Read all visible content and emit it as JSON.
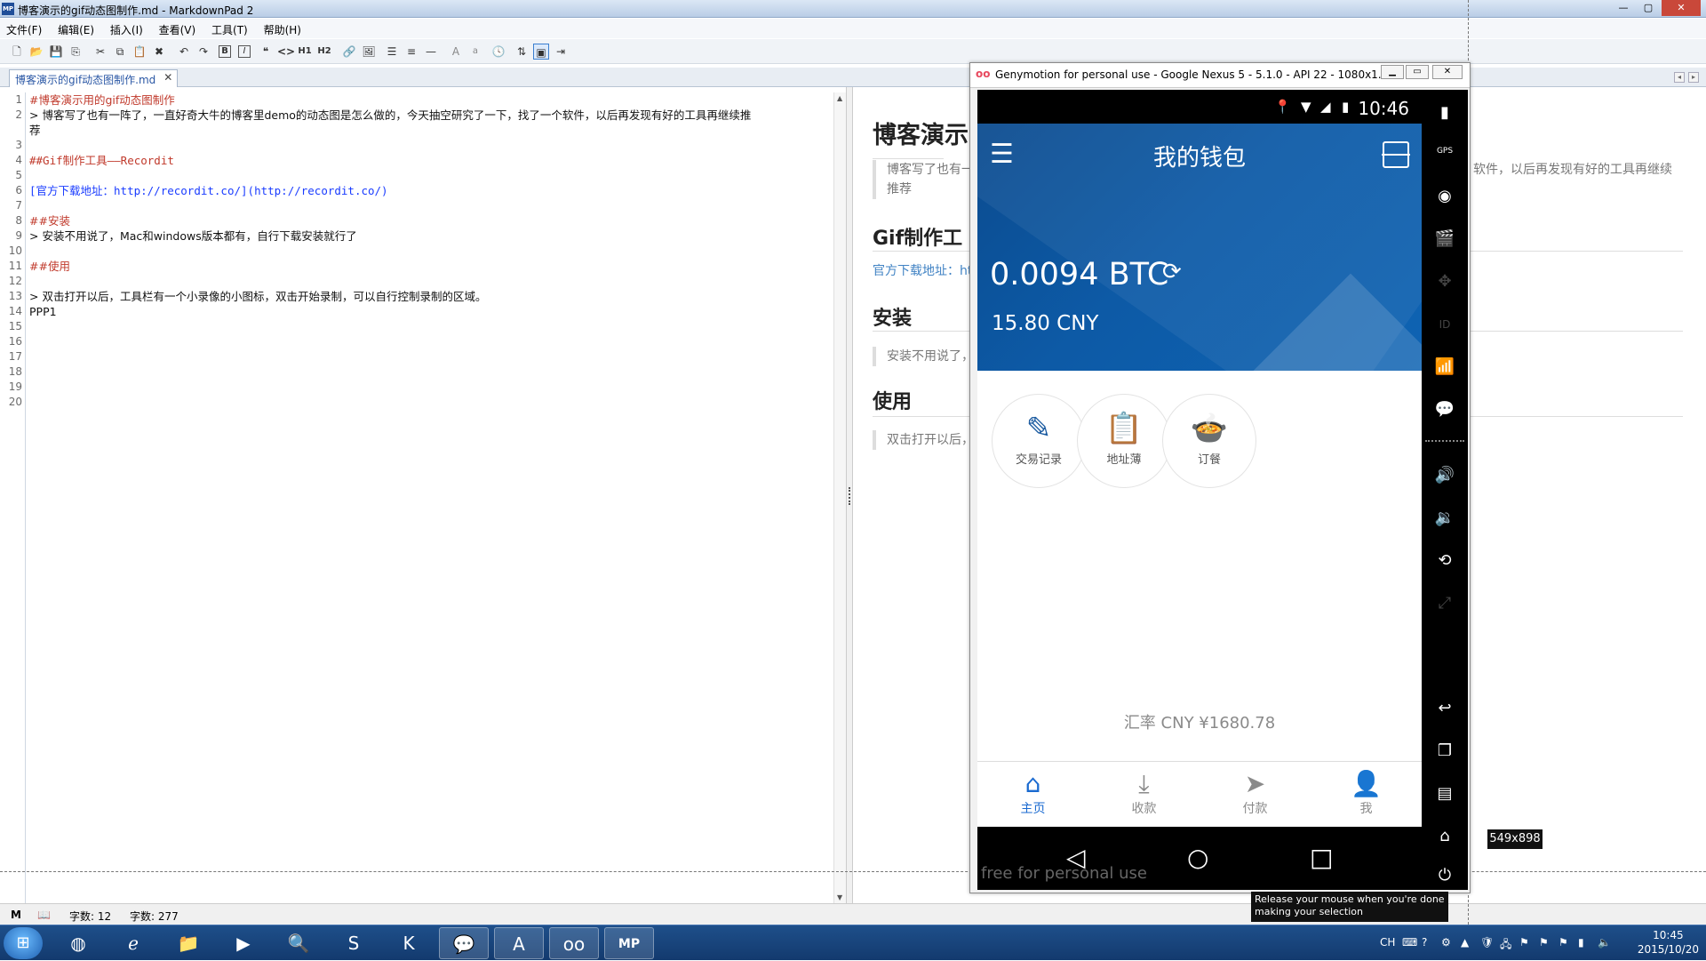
{
  "window": {
    "title": "博客演示的gif动态图制作.md - MarkdownPad 2",
    "app_badge": "MP",
    "controls": [
      "—",
      "▢",
      "✕"
    ]
  },
  "menu": [
    "文件(F)",
    "编辑(E)",
    "插入(I)",
    "查看(V)",
    "工具(T)",
    "帮助(H)"
  ],
  "toolbar": {
    "buttons": [
      "B",
      "I",
      "❝",
      "<>",
      "H1",
      "H2",
      "A",
      "a"
    ]
  },
  "tab": {
    "label": "博客演示的gif动态图制作.md",
    "close": "✕"
  },
  "editor": {
    "line_numbers": [
      "1",
      "2",
      "3",
      "4",
      "5",
      "6",
      "7",
      "8",
      "9",
      "10",
      "11",
      "12",
      "13",
      "14",
      "15",
      "16",
      "17",
      "18",
      "19",
      "20"
    ],
    "lines": {
      "l1": "#博客演示用的gif动态图制作",
      "l2": "> 博客写了也有一阵了，一直好奇大牛的博客里demo的动态图是怎么做的，今天抽空研究了一下，找了一个软件，以后再发现有好的工具再继续推",
      "l2b": "荐",
      "l4": "##Gif制作工具——Recordit",
      "l6": "[官方下载地址：http://recordit.co/](http://recordit.co/)",
      "l8": "##安装",
      "l9": "> 安装不用说了，Mac和windows版本都有，自行下载安装就行了",
      "l11": "##使用",
      "l13": "> 双击打开以后，工具栏有一个小录像的小图标，双击开始录制，可以自行控制录制的区域。",
      "l14": "PPP1"
    }
  },
  "preview": {
    "h1": "博客演示",
    "quote1": "博客写了也有一",
    "quote1_right": "软件，以后再发现有好的工具再继续",
    "quote1_right2": "推荐",
    "h2_tool": "Gif制作工",
    "link": "官方下载地址：ht",
    "h2_install": "安装",
    "quote_install": "安装不用说了，",
    "h2_use": "使用",
    "quote_use": "双击打开以后，"
  },
  "status": {
    "word_count_1": "字数: 12",
    "word_count_2": "字数: 277"
  },
  "genymotion": {
    "title": "Genymotion for personal use - Google Nexus 5 - 5.1.0 - API 22 - 1080x1...",
    "logo": "oo",
    "sidebar_labels": {
      "gps": "GPS",
      "id": "ID"
    },
    "watermark": "free for personal use"
  },
  "phone": {
    "time": "10:46",
    "wallet_title": "我的钱包",
    "btc_amount": "0.0094 BTC",
    "cny_amount": "15.80  CNY",
    "actions": [
      "交易记录",
      "地址薄",
      "订餐"
    ],
    "rate": "汇率  CNY ¥1680.78",
    "nav": [
      "主页",
      "收款",
      "付款",
      "我"
    ],
    "nav_active": "主页"
  },
  "overlay": {
    "size_label": "549x898",
    "tooltip_line1": "Release your mouse when you're done",
    "tooltip_line2": "making your selection"
  },
  "taskbar": {
    "tray_lang": "CH",
    "clock_time": "10:45",
    "clock_date": "2015/10/20"
  },
  "colors": {
    "wallet_blue": "#0d5aa6",
    "nav_active": "#1a6ad0",
    "markdown_heading": "#c0392b",
    "markdown_link": "#1a3cff"
  }
}
